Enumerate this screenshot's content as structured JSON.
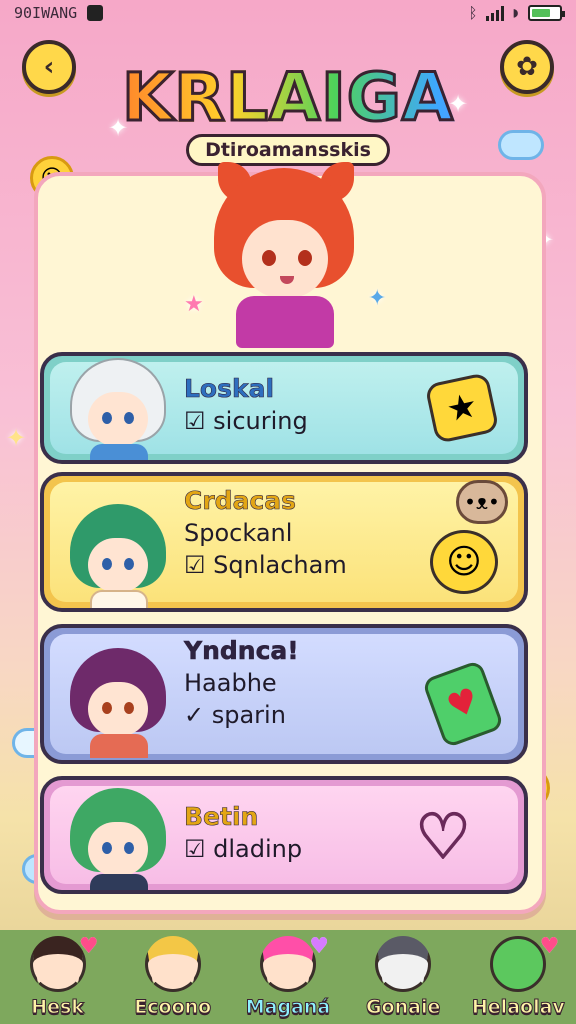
{
  "status_bar": {
    "left_text": "90IWANG",
    "signal_glyph": "▮"
  },
  "header": {
    "back_glyph": "‹",
    "settings_glyph": "✿",
    "title": "KRLAIGA",
    "subtitle": "Dtiroamansskis"
  },
  "cards": [
    {
      "title": "Loskal",
      "line1": "☑ sicuring",
      "line2": "",
      "badge_icon": "star-wrench-icon",
      "badge_glyph": "★"
    },
    {
      "title": "Crdacas",
      "line1": "Spockanl",
      "line2": "☑ Sqnlacham",
      "badge_icon": "smile-face-icon",
      "badge_glyph": "☺"
    },
    {
      "title": "Yndnca!",
      "line1": "Haabhe",
      "line2": "✓ sparin",
      "badge_icon": "heart-gem-icon",
      "badge_glyph": "♥"
    },
    {
      "title": "Betin",
      "line1": "☑ dladinp",
      "line2": "",
      "badge_icon": "heart-outline-icon",
      "badge_glyph": "♡"
    }
  ],
  "nav": [
    {
      "label": "Hesk",
      "active": false
    },
    {
      "label": "Ecoono",
      "active": false
    },
    {
      "label": "Maganá",
      "active": true
    },
    {
      "label": "Gonaie",
      "active": false
    },
    {
      "label": "Helaolav",
      "active": false
    }
  ],
  "colors": {
    "accent_yellow": "#ffd84a",
    "panel": "#fff6d4",
    "nav_bg": "#7ea85d"
  }
}
